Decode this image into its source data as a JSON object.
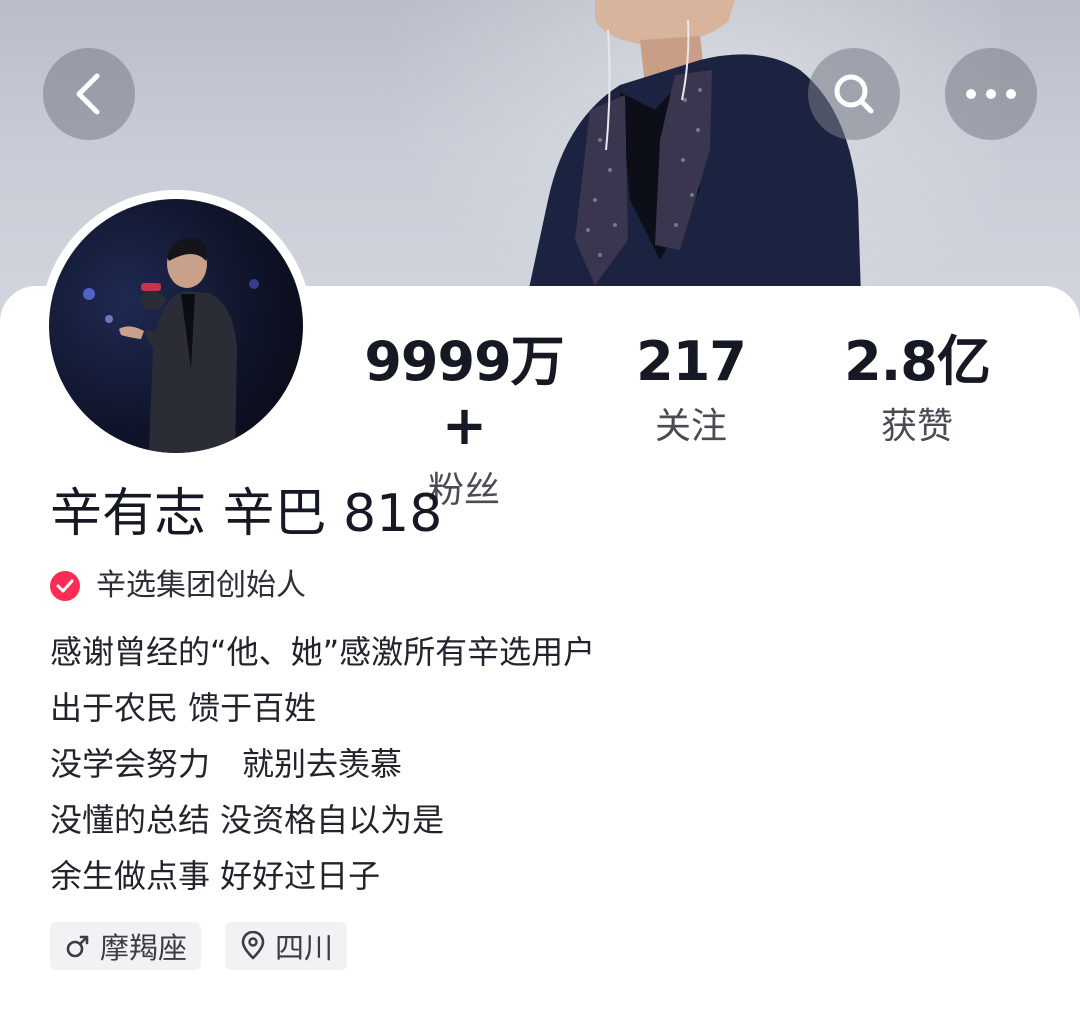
{
  "header": {
    "back_icon": "chevron-left-icon",
    "search_icon": "search-icon",
    "more_icon": "more-dots-icon"
  },
  "profile": {
    "name": "辛有志 辛巴 818",
    "verification": {
      "icon": "verified-check-icon",
      "color": "#fe2c55",
      "text": "辛选集团创始人"
    },
    "stats": [
      {
        "value": "9999万+",
        "label": "粉丝"
      },
      {
        "value": "217",
        "label": "关注"
      },
      {
        "value": "2.8亿",
        "label": "获赞"
      }
    ],
    "bio": [
      "感谢曾经的“他、她”感激所有辛选用户",
      "出于农民 馈于百姓",
      "没学会努力　就别去羡慕",
      "没懂的总结 没资格自以为是",
      "余生做点事 好好过日子"
    ],
    "tags": [
      {
        "icon": "male-icon",
        "label": "摩羯座"
      },
      {
        "icon": "location-pin-icon",
        "label": "四川"
      }
    ]
  }
}
